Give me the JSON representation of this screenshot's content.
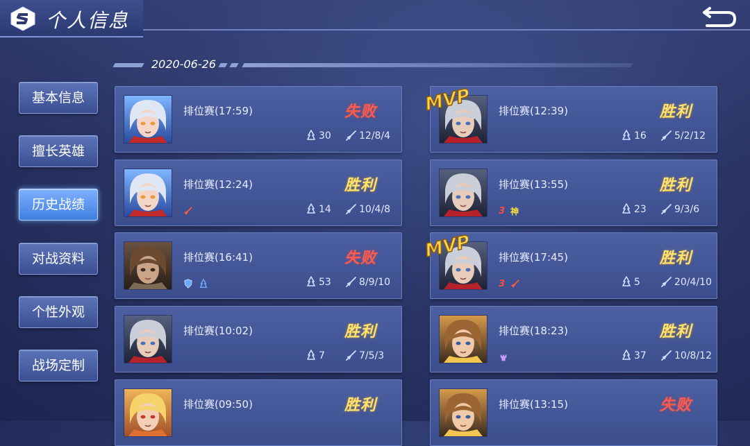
{
  "header": {
    "title": "个人信息"
  },
  "date": "2020-06-26",
  "sidebar": {
    "items": [
      {
        "label": "基本信息",
        "active": false
      },
      {
        "label": "擅长英雄",
        "active": false
      },
      {
        "label": "历史战绩",
        "active": true
      },
      {
        "label": "对战资料",
        "active": false
      },
      {
        "label": "个性外观",
        "active": false
      },
      {
        "label": "战场定制",
        "active": false
      }
    ]
  },
  "matches": [
    {
      "mode": "排位赛(17:59)",
      "result": "失败",
      "outcome": "lose",
      "stat_a": "30",
      "kda": "12/8/4",
      "mvp": false,
      "hero": "silver-hair-female"
    },
    {
      "mode": "排位赛(12:39)",
      "result": "胜利",
      "outcome": "win",
      "stat_a": "16",
      "kda": "5/2/12",
      "mvp": true,
      "hero": "silver-hair-male"
    },
    {
      "mode": "排位赛(12:24)",
      "result": "胜利",
      "outcome": "win",
      "stat_a": "14",
      "kda": "10/4/8",
      "mvp": false,
      "hero": "silver-hair-female"
    },
    {
      "mode": "排位赛(13:55)",
      "result": "胜利",
      "outcome": "win",
      "stat_a": "23",
      "kda": "9/3/6",
      "mvp": false,
      "hero": "silver-hair-male",
      "badge_num": "3",
      "badge_god": "神"
    },
    {
      "mode": "排位赛(16:41)",
      "result": "失败",
      "outcome": "lose",
      "stat_a": "53",
      "kda": "8/9/10",
      "mvp": false,
      "hero": "brown-hair-male"
    },
    {
      "mode": "排位赛(17:45)",
      "result": "胜利",
      "outcome": "win",
      "stat_a": "5",
      "kda": "20/4/10",
      "mvp": true,
      "hero": "silver-hair-male",
      "badge_num": "3"
    },
    {
      "mode": "排位赛(10:02)",
      "result": "胜利",
      "outcome": "win",
      "stat_a": "7",
      "kda": "7/5/3",
      "mvp": false,
      "hero": "silver-hair-male"
    },
    {
      "mode": "排位赛(18:23)",
      "result": "胜利",
      "outcome": "win",
      "stat_a": "37",
      "kda": "10/8/12",
      "mvp": false,
      "hero": "gold-hair-male"
    },
    {
      "mode": "排位赛(09:50)",
      "result": "胜利",
      "outcome": "win",
      "stat_a": "",
      "kda": "",
      "mvp": false,
      "hero": "blonde-hair-male"
    },
    {
      "mode": "排位赛(13:15)",
      "result": "失败",
      "outcome": "lose",
      "stat_a": "",
      "kda": "",
      "mvp": false,
      "hero": "gold-hair-male"
    }
  ],
  "colors": {
    "win": "#ffe270",
    "lose": "#ff5a4e",
    "accent": "#7e94d6"
  }
}
